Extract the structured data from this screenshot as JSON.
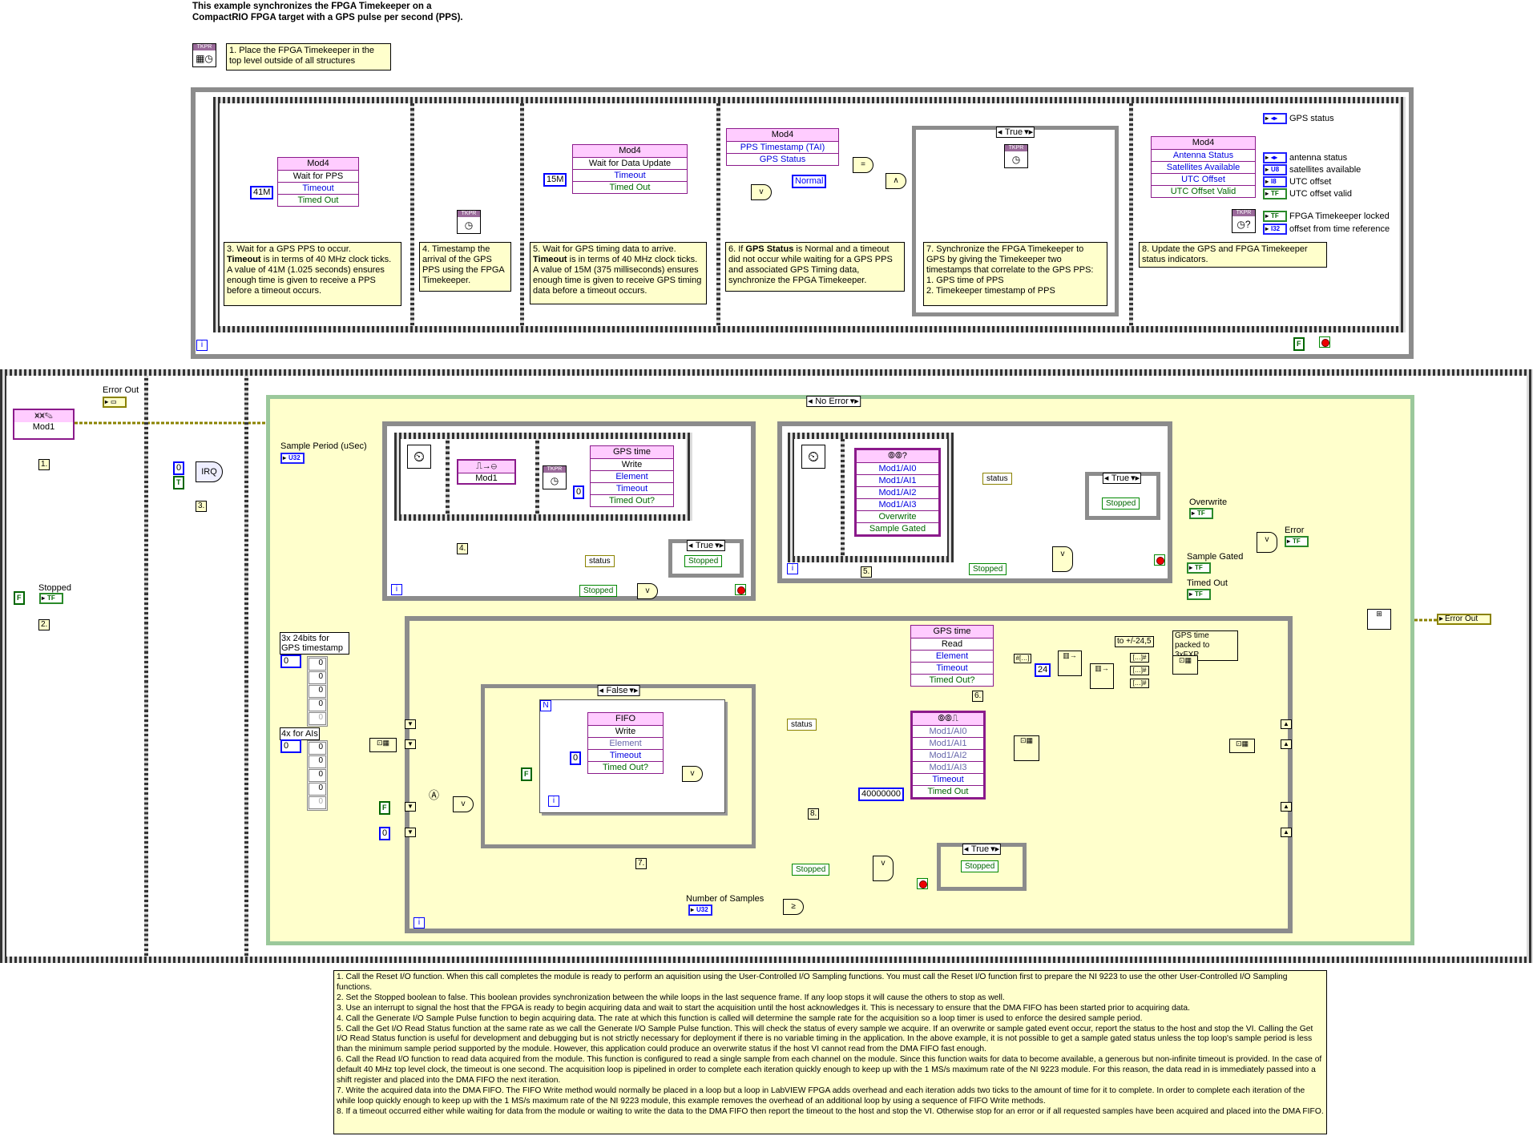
{
  "header": {
    "title_line1": "This example synchronizes the FPGA Timekeeper on a",
    "title_line2": "CompactRIO FPGA target with a GPS pulse per second (PPS)."
  },
  "tkpr_label": "TKPR",
  "step1_note": "1. Place the FPGA Timekeeper in the top level outside of all structures",
  "top_loop": {
    "notes": {
      "s3": {
        "a": "3. Wait for a GPS PPS to occur.",
        "b": "Timeout",
        "c": " is in terms of 40 MHz clock ticks. A value of 41M (1.025 seconds) ensures enough time is given to receive a PPS before a timeout occurs."
      },
      "s4": "4. Timestamp the arrival of the GPS PPS using the FPGA Timekeeper.",
      "s5": {
        "a": "5. Wait for GPS timing data to arrive.",
        "b": "Timeout",
        "c": " is in terms of 40 MHz clock ticks. A value of 15M (375 milliseconds) ensures enough time is given to receive GPS timing data before a timeout occurs."
      },
      "s6": {
        "a": "6. If ",
        "b": "GPS Status",
        "c": " is Normal and a timeout did not occur while waiting for a GPS PPS and associated GPS Timing data, synchronize the FPGA Timekeeper."
      },
      "s7": "7. Synchronize the FPGA Timekeeper to GPS by giving the Timekeeper two timestamps that correlate to the GPS PPS:\n1. GPS time of PPS\n2. Timekeeper timestamp of PPS",
      "s8": "8. Update the GPS and FPGA Timekeeper status indicators."
    },
    "wait_pps": {
      "module": "Mod4",
      "method": "Wait for PPS",
      "in": "Timeout",
      "out": "Timed Out",
      "timeout_const": "41M"
    },
    "wait_data": {
      "module": "Mod4",
      "method": "Wait for Data Update",
      "in": "Timeout",
      "out": "Timed Out",
      "timeout_const": "15M"
    },
    "props": {
      "module": "Mod4",
      "p1": "PPS Timestamp (TAI)",
      "p2": "GPS Status"
    },
    "normal_const": "Normal",
    "case_selector": "True",
    "status_props": {
      "module": "Mod4",
      "p1": "Antenna Status",
      "p2": "Satellites Available",
      "p3": "UTC Offset",
      "p4": "UTC Offset Valid"
    },
    "indicators": [
      {
        "type": "enum",
        "label": "GPS status"
      },
      {
        "type": "enum",
        "label": "antenna status"
      },
      {
        "type": "U8",
        "label": "satellites available"
      },
      {
        "type": "I8",
        "label": "UTC offset"
      },
      {
        "type": "TF",
        "label": "UTC offset valid"
      },
      {
        "type": "TF",
        "label": "FPGA Timekeeper locked"
      },
      {
        "type": "I32",
        "label": "offset from time reference"
      }
    ],
    "iter": "i",
    "stop_const": "F"
  },
  "frame1": {
    "reset_module": "Mod1",
    "error_out_label": "Error Out",
    "step": "1.",
    "stopped_label": "Stopped",
    "stopped_const": "F",
    "tf": "TF",
    "step2": "2."
  },
  "frame2": {
    "irq_const": "0",
    "wait_const": "T",
    "irq": "IRQ",
    "step": "3."
  },
  "frame3": {
    "case_selector": "No Error",
    "sample_period_label": "Sample Period (uSec)",
    "u32": "U32",
    "timing_loop": {
      "gen_module": "Mod1",
      "fifo": "GPS time",
      "method": "Write",
      "element": "Element",
      "timeout": "Timeout",
      "timed_out": "Timed Out?",
      "timeout_const": "0",
      "step": "4.",
      "status": "status",
      "stopped": "Stopped",
      "case_selector": "True",
      "iter": "i"
    },
    "status_loop": {
      "rows": [
        "Mod1/AI0",
        "Mod1/AI1",
        "Mod1/AI2",
        "Mod1/AI3"
      ],
      "overwrite": "Overwrite",
      "sample_gated": "Sample Gated",
      "status": "status",
      "case_selector": "True",
      "stopped": "Stopped",
      "step": "5.",
      "iter": "i"
    },
    "outputs": {
      "overwrite": "Overwrite",
      "error": "Error",
      "sample_gated": "Sample Gated",
      "timed_out": "Timed Out",
      "error_out": "Error Out",
      "tf": "TF"
    },
    "acq_loop": {
      "gps_array_label": "3x 24bits for GPS timestamp",
      "gps_index": "0",
      "gps_values": [
        "0",
        "0",
        "0",
        "0",
        "0"
      ],
      "ai_array_label": "4x for AIs",
      "ai_index": "0",
      "ai_values": [
        "0",
        "0",
        "0",
        "0",
        "0"
      ],
      "false_const": "F",
      "zero_const": "0",
      "inner_case": "False",
      "n": "N",
      "fifo": {
        "name": "FIFO",
        "method": "Write",
        "element": "Element",
        "timeout": "Timeout",
        "timed_out": "Timed Out?",
        "timeout_const": "0",
        "false_const": "F"
      },
      "step7": "7.",
      "step8": "8.",
      "status": "status",
      "gps_read": {
        "fifo": "GPS time",
        "method": "Read",
        "element": "Element",
        "timeout": "Timeout",
        "timed_out": "Timed Out?"
      },
      "step6": "6.",
      "read_io": {
        "rows": [
          "Mod1/AI0",
          "Mod1/AI1",
          "Mod1/AI2",
          "Mod1/AI3"
        ],
        "timeout": "Timeout",
        "timed_out": "Timed Out"
      },
      "timeout_const": "40000000",
      "shift_const": "24",
      "label_fxp": "to +/-24,5",
      "label_packed": "GPS time packed to 3xFXP",
      "stopped": "Stopped",
      "case_selector": "True",
      "num_samples_label": "Number of Samples",
      "u32": "U32",
      "iter": "i"
    }
  },
  "comment": [
    "1.  Call the Reset I/O function.  When this call completes the module is ready to perform an aquisition using the User-Controlled I/O Sampling functions.  You must call the Reset I/O function first to prepare the NI 9223 to use the other User-Controlled I/O Sampling functions.",
    "2.  Set the Stopped boolean to false.  This boolean provides synchronization between the while loops in the last sequence frame.  If any loop stops it will cause the others to stop as well.",
    "3.  Use an interrupt to signal the host that the FPGA is ready to begin acquiring data and wait to start the acquisition until the host acknowledges it.  This is necessary to ensure that the DMA FIFO has been started prior to acquiring data.",
    "4.  Call the Generate I/O Sample Pulse function to begin acquiring data.  The rate at which this function is called will determine the sample rate for the acquisition so a loop timer is used to enforce the desired sample period.",
    "5.  Call the Get I/O Read Status function at the same rate as we call the Generate I/O Sample Pulse function.  This will check the status of every sample we acquire.  If an overwrite or sample gated event occur, report the status to the host and stop the VI.  Calling the Get I/O Read Status function is useful for development and debugging but is not strictly necessary for deployment if there is no variable timing in the application.  In the above example, it is not possible to get a sample gated status unless the top loop's sample period is less than the minimum sample period supported by the module.  However, this application could produce an overwrite status if the host VI cannot read from the DMA FIFO fast enough.",
    "6.  Call the Read I/O function to read data acquired from the module.  This function is configured to read a single sample from each channel on the module.  Since this function waits for data to become available, a generous but non-infinite timeout is provided.  In the case of default 40 MHz top level clock, the timeout is one second.  The acquisition loop is pipelined in order to complete each iteration quickly enough to keep up with the 1 MS/s maximum rate of the NI 9223 module.  For this reason, the data read in is immediately passed into a shift register and placed into the DMA FIFO the next iteration.",
    "7.  Write the acquired data into the DMA FIFO.  The FIFO Write method would normally be placed in a loop but a loop in LabVIEW FPGA adds overhead and each iteration adds two ticks to the amount of time for it to complete.  In order to complete each iteration of the while loop quickly enough to keep up with the 1 MS/s maximum rate of the NI 9223 module, this example removes the overhead of an additional loop by using a sequence of FIFO Write methods.",
    "8.  If a timeout occurred either while waiting for data from the module or waiting to write the data to the DMA FIFO then report the timeout to the host and stop the VI.  Otherwise stop for an error or if all requested samples have been acquired and placed into the DMA FIFO."
  ],
  "colors": {
    "node_border": "#8b1a8b",
    "node_header": "#ffccff",
    "comment_bg": "#ffffcc",
    "int_wire": "#0000ff",
    "bool_wire": "#006600",
    "error_wire": "#8a8200",
    "array_wire": "#6b6ba8",
    "loop_border": "#8c8c8c"
  },
  "icons": [
    "tkpr-timekeeper-icon",
    "loop-timer-icon",
    "stop-icon",
    "iteration-icon",
    "irq-icon",
    "or-gate-icon",
    "and-gate-icon",
    "equal-icon",
    "build-array-icon",
    "shift-register-icon"
  ]
}
